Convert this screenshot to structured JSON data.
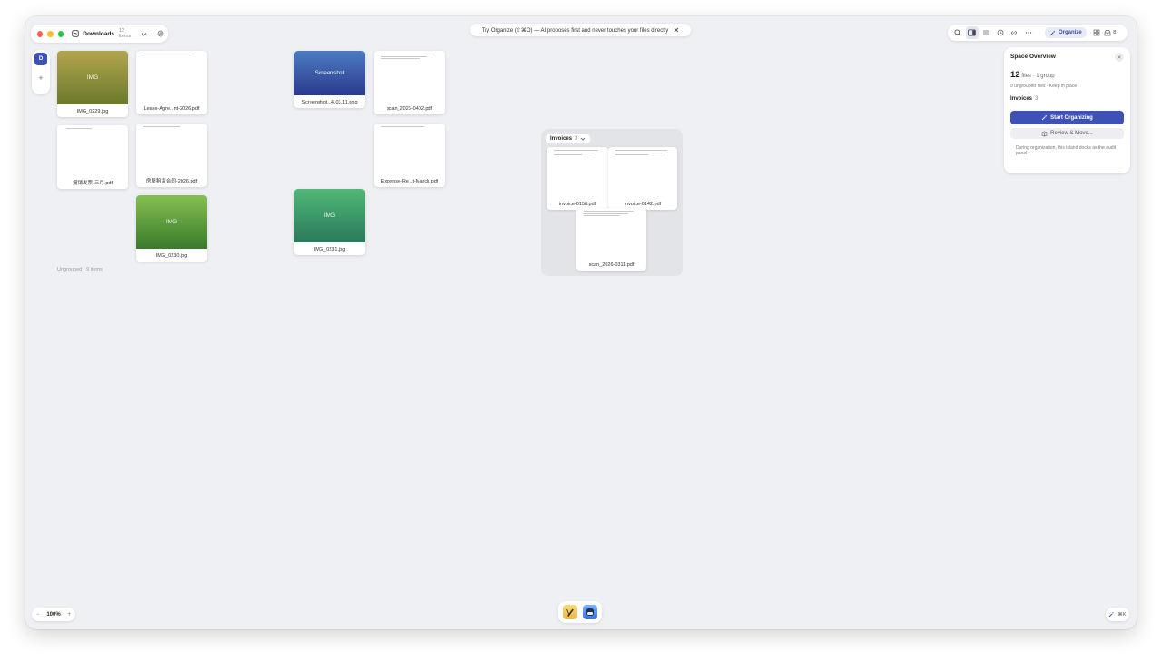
{
  "window": {
    "title": "Downloads",
    "item_count": "12 items",
    "traffic_colors": {
      "close": "#ff5f57",
      "minimize": "#febc2e",
      "zoom": "#28c840"
    }
  },
  "banner": {
    "text": "Try Organize (⇧⌘O) — AI proposes first and never touches your files directly"
  },
  "toolbar": {
    "organize_label": "Organize",
    "badge_count": "8",
    "icons": [
      "search-icon",
      "sidebar-panel-icon",
      "list-icon",
      "history-icon",
      "link-icon",
      "more-icon",
      "grid-icon",
      "tray-icon"
    ]
  },
  "sidebar": {
    "avatar_letter": "D"
  },
  "files": [
    {
      "name": "IMG_0229.jpg",
      "kind": "image",
      "thumb_label": "IMG"
    },
    {
      "name": "Lease-Agre...nt-2026.pdf",
      "kind": "pdf"
    },
    {
      "name": "Screenshot...4.03.11.png",
      "kind": "image",
      "thumb_label": "Screenshot"
    },
    {
      "name": "scan_2026-0402.pdf",
      "kind": "pdf"
    },
    {
      "name": "报销发票-三月.pdf",
      "kind": "pdf"
    },
    {
      "name": "房屋租赁合同-2026.pdf",
      "kind": "pdf"
    },
    {
      "name": "Expense-Re...t-March.pdf",
      "kind": "pdf"
    },
    {
      "name": "IMG_0230.jpg",
      "kind": "image",
      "thumb_label": "IMG"
    },
    {
      "name": "IMG_0231.jpg",
      "kind": "image",
      "thumb_label": "IMG"
    }
  ],
  "ungrouped_label": "Ungrouped · 9 items",
  "group": {
    "name": "Invoices",
    "count": "3",
    "files": [
      "invoice-0158.pdf",
      "invoice-0142.pdf",
      "scan_2026-0311.pdf"
    ]
  },
  "panel": {
    "title": "Space Overview",
    "file_count": "12",
    "file_suffix": "files · 1 group",
    "sub": "9 ungrouped files · Keep in place",
    "group_name": "Invoices",
    "group_count": "3",
    "primary_button": "Start Organizing",
    "secondary_button": "Review & Move...",
    "note": "During organization, this island docks as the audit panel",
    "accent": "#3f51b5"
  },
  "zoom": {
    "level": "100%",
    "minus": "−",
    "plus": "+"
  },
  "shortcut": {
    "label": "⌘K"
  },
  "colors": {
    "canvas": "#eff0f3",
    "accent": "#3f51b5"
  }
}
